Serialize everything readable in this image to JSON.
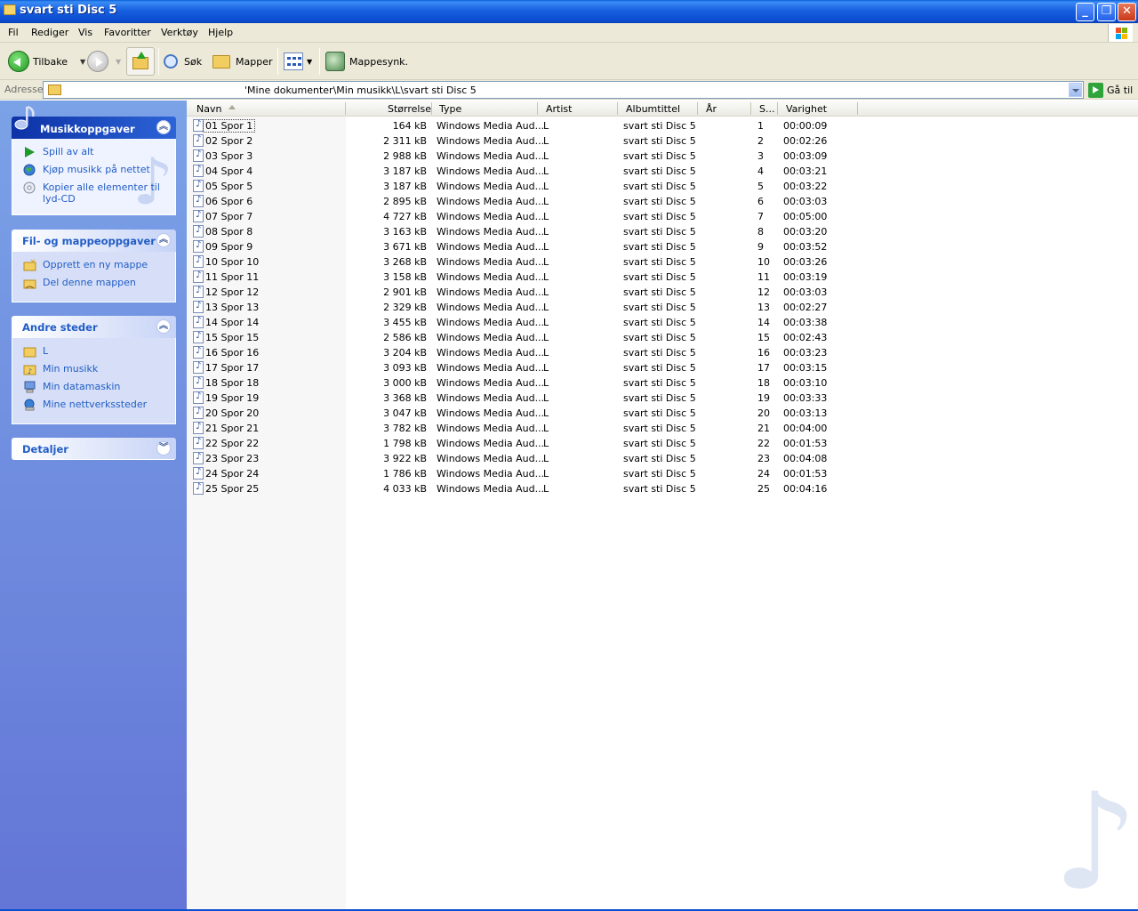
{
  "window": {
    "title": "svart sti Disc 5"
  },
  "menu": [
    "Fil",
    "Rediger",
    "Vis",
    "Favoritter",
    "Verktøy",
    "Hjelp"
  ],
  "toolbar": {
    "back": "Tilbake",
    "search": "Søk",
    "folders": "Mapper",
    "sync": "Mappesynk."
  },
  "address": {
    "label": "Adresse",
    "path": "'Mine dokumenter\\Min musikk\\L\\svart sti Disc 5",
    "go": "Gå til"
  },
  "panels": {
    "music": {
      "title": "Musikkoppgaver",
      "items": [
        "Spill av alt",
        "Kjøp musikk på nettet",
        "Kopier alle elementer til lyd-CD"
      ]
    },
    "file": {
      "title": "Fil- og mappeoppgaver",
      "items": [
        "Opprett en ny mappe",
        "Del denne mappen"
      ]
    },
    "other": {
      "title": "Andre steder",
      "items": [
        "L",
        "Min musikk",
        "Min datamaskin",
        "Mine nettverkssteder"
      ]
    },
    "details": {
      "title": "Detaljer"
    }
  },
  "columns": {
    "name": "Navn",
    "size": "Størrelse",
    "type": "Type",
    "artist": "Artist",
    "album": "Albumtittel",
    "year": "År",
    "track": "S...",
    "duration": "Varighet"
  },
  "files": [
    {
      "name": "01 Spor 1",
      "size": "164 kB",
      "type": "Windows Media Aud...",
      "artist": "L",
      "album": "svart sti Disc 5",
      "track": "1",
      "duration": "00:00:09"
    },
    {
      "name": "02 Spor 2",
      "size": "2 311 kB",
      "type": "Windows Media Aud...",
      "artist": "L",
      "album": "svart sti Disc 5",
      "track": "2",
      "duration": "00:02:26"
    },
    {
      "name": "03 Spor 3",
      "size": "2 988 kB",
      "type": "Windows Media Aud...",
      "artist": "L",
      "album": "svart sti Disc 5",
      "track": "3",
      "duration": "00:03:09"
    },
    {
      "name": "04 Spor 4",
      "size": "3 187 kB",
      "type": "Windows Media Aud...",
      "artist": "L",
      "album": "svart sti Disc 5",
      "track": "4",
      "duration": "00:03:21"
    },
    {
      "name": "05 Spor 5",
      "size": "3 187 kB",
      "type": "Windows Media Aud...",
      "artist": "L",
      "album": "svart sti Disc 5",
      "track": "5",
      "duration": "00:03:22"
    },
    {
      "name": "06 Spor 6",
      "size": "2 895 kB",
      "type": "Windows Media Aud...",
      "artist": "L",
      "album": "svart sti Disc 5",
      "track": "6",
      "duration": "00:03:03"
    },
    {
      "name": "07 Spor 7",
      "size": "4 727 kB",
      "type": "Windows Media Aud...",
      "artist": "L",
      "album": "svart sti Disc 5",
      "track": "7",
      "duration": "00:05:00"
    },
    {
      "name": "08 Spor 8",
      "size": "3 163 kB",
      "type": "Windows Media Aud...",
      "artist": "L",
      "album": "svart sti Disc 5",
      "track": "8",
      "duration": "00:03:20"
    },
    {
      "name": "09 Spor 9",
      "size": "3 671 kB",
      "type": "Windows Media Aud...",
      "artist": "L",
      "album": "svart sti Disc 5",
      "track": "9",
      "duration": "00:03:52"
    },
    {
      "name": "10 Spor 10",
      "size": "3 268 kB",
      "type": "Windows Media Aud...",
      "artist": "L",
      "album": "svart sti Disc 5",
      "track": "10",
      "duration": "00:03:26"
    },
    {
      "name": "11 Spor 11",
      "size": "3 158 kB",
      "type": "Windows Media Aud...",
      "artist": "L",
      "album": "svart sti Disc 5",
      "track": "11",
      "duration": "00:03:19"
    },
    {
      "name": "12 Spor 12",
      "size": "2 901 kB",
      "type": "Windows Media Aud...",
      "artist": "L",
      "album": "svart sti Disc 5",
      "track": "12",
      "duration": "00:03:03"
    },
    {
      "name": "13 Spor 13",
      "size": "2 329 kB",
      "type": "Windows Media Aud...",
      "artist": "L",
      "album": "svart sti Disc 5",
      "track": "13",
      "duration": "00:02:27"
    },
    {
      "name": "14 Spor 14",
      "size": "3 455 kB",
      "type": "Windows Media Aud...",
      "artist": "L",
      "album": "svart sti Disc 5",
      "track": "14",
      "duration": "00:03:38"
    },
    {
      "name": "15 Spor 15",
      "size": "2 586 kB",
      "type": "Windows Media Aud...",
      "artist": "L",
      "album": "svart sti Disc 5",
      "track": "15",
      "duration": "00:02:43"
    },
    {
      "name": "16 Spor 16",
      "size": "3 204 kB",
      "type": "Windows Media Aud...",
      "artist": "L",
      "album": "svart sti Disc 5",
      "track": "16",
      "duration": "00:03:23"
    },
    {
      "name": "17 Spor 17",
      "size": "3 093 kB",
      "type": "Windows Media Aud...",
      "artist": "L",
      "album": "svart sti Disc 5",
      "track": "17",
      "duration": "00:03:15"
    },
    {
      "name": "18 Spor 18",
      "size": "3 000 kB",
      "type": "Windows Media Aud...",
      "artist": "L",
      "album": "svart sti Disc 5",
      "track": "18",
      "duration": "00:03:10"
    },
    {
      "name": "19 Spor 19",
      "size": "3 368 kB",
      "type": "Windows Media Aud...",
      "artist": "L",
      "album": "svart sti Disc 5",
      "track": "19",
      "duration": "00:03:33"
    },
    {
      "name": "20 Spor 20",
      "size": "3 047 kB",
      "type": "Windows Media Aud...",
      "artist": "L",
      "album": "svart sti Disc 5",
      "track": "20",
      "duration": "00:03:13"
    },
    {
      "name": "21 Spor 21",
      "size": "3 782 kB",
      "type": "Windows Media Aud...",
      "artist": "L",
      "album": "svart sti Disc 5",
      "track": "21",
      "duration": "00:04:00"
    },
    {
      "name": "22 Spor 22",
      "size": "1 798 kB",
      "type": "Windows Media Aud...",
      "artist": "L",
      "album": "svart sti Disc 5",
      "track": "22",
      "duration": "00:01:53"
    },
    {
      "name": "23 Spor 23",
      "size": "3 922 kB",
      "type": "Windows Media Aud...",
      "artist": "L",
      "album": "svart sti Disc 5",
      "track": "23",
      "duration": "00:04:08"
    },
    {
      "name": "24 Spor 24",
      "size": "1 786 kB",
      "type": "Windows Media Aud...",
      "artist": "L",
      "album": "svart sti Disc 5",
      "track": "24",
      "duration": "00:01:53"
    },
    {
      "name": "25 Spor 25",
      "size": "4 033 kB",
      "type": "Windows Media Aud...",
      "artist": "L",
      "album": "svart sti Disc 5",
      "track": "25",
      "duration": "00:04:16"
    }
  ]
}
